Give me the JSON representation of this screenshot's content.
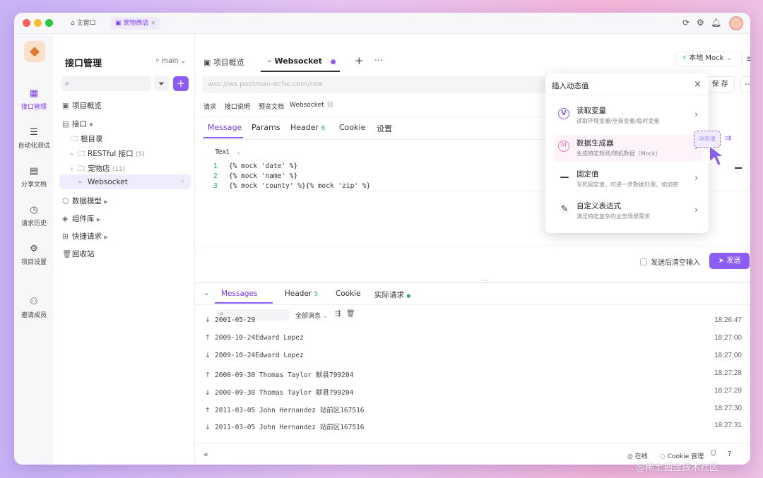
{
  "titlebar": {
    "home_tab": "主窗口",
    "project_tab": "宠物商店"
  },
  "rail": [
    {
      "label": "接口管理",
      "icon": "api-icon"
    },
    {
      "label": "自动化测试",
      "icon": "automation-icon"
    },
    {
      "label": "分享文档",
      "icon": "doc-icon"
    },
    {
      "label": "请求历史",
      "icon": "history-icon"
    },
    {
      "label": "项目设置",
      "icon": "settings-icon"
    },
    {
      "label": "邀请成员",
      "icon": "invite-icon"
    }
  ],
  "sidebar": {
    "title": "接口管理",
    "branch": "main",
    "tree": [
      {
        "label": "项目概览"
      },
      {
        "label": "接口"
      },
      {
        "label": "根目录"
      },
      {
        "label": "RESTful 接口",
        "count": "(5)"
      },
      {
        "label": "宠物店",
        "count": "(11)"
      },
      {
        "label": "Websocket"
      },
      {
        "label": "数据模型"
      },
      {
        "label": "组件库"
      },
      {
        "label": "快捷请求"
      },
      {
        "label": "回收站"
      }
    ]
  },
  "tabs": {
    "overview": "项目概览",
    "websocket": "Websocket",
    "env": "本地 Mock"
  },
  "url": {
    "placeholder": "wss://ws.postman-echo.com/raw",
    "save": "保 存"
  },
  "subtabs": [
    "请求",
    "接口说明",
    "预览文档",
    "Websocket"
  ],
  "msgtabs": {
    "message": "Message",
    "params": "Params",
    "header": "Header",
    "header_count": "6",
    "cookie": "Cookie",
    "settings": "设置"
  },
  "editor": {
    "format": "Text",
    "lines": [
      "{% mock 'date' %}",
      "{% mock 'name' %}",
      "{% mock 'county' %}{% mock 'zip' %}"
    ],
    "clear_after_send": "发送后清空输入",
    "send": "发送"
  },
  "popover": {
    "title": "插入动态值",
    "items": [
      {
        "title": "读取变量",
        "sub": "读取环境变量/全局变量/临时变量"
      },
      {
        "title": "数据生成器",
        "sub": "生成特定规则/随机数据（Mock）"
      },
      {
        "title": "固定值",
        "sub": "写死固定值，可进一步数据处理，如加密"
      },
      {
        "title": "自定义表达式",
        "sub": "满足特定复杂的业务场景需求"
      }
    ],
    "dynamic_tag": "动态值"
  },
  "bottom": {
    "tabs": {
      "messages": "Messages",
      "header": "Header",
      "header_count": "5",
      "cookie": "Cookie",
      "actual": "实际请求"
    },
    "filter": "全部消息",
    "messages": [
      {
        "dir": "down",
        "text": "2001-05-29",
        "time": "18:26:47"
      },
      {
        "dir": "up",
        "text": "2009-10-24Edward Lopez",
        "time": "18:27:00"
      },
      {
        "dir": "down",
        "text": "2009-10-24Edward Lopez",
        "time": "18:27:00"
      },
      {
        "dir": "up",
        "text": "2000-09-30 Thomas Taylor 献县799204",
        "time": "18:27:28"
      },
      {
        "dir": "down",
        "text": "2000-09-30 Thomas Taylor 献县799204",
        "time": "18:27:29"
      },
      {
        "dir": "up",
        "text": "2011-03-05 John Hernandez 站前区167516",
        "time": "18:27:30"
      },
      {
        "dir": "down",
        "text": "2011-03-05 John Hernandez 站前区167516",
        "time": "18:27:31"
      }
    ]
  },
  "status": {
    "online": "在线",
    "cookie": "Cookie 管理"
  },
  "watermark": "@稀土掘金技术社区",
  "colors": {
    "accent": "#8b5cf6",
    "green": "#3cb371"
  }
}
